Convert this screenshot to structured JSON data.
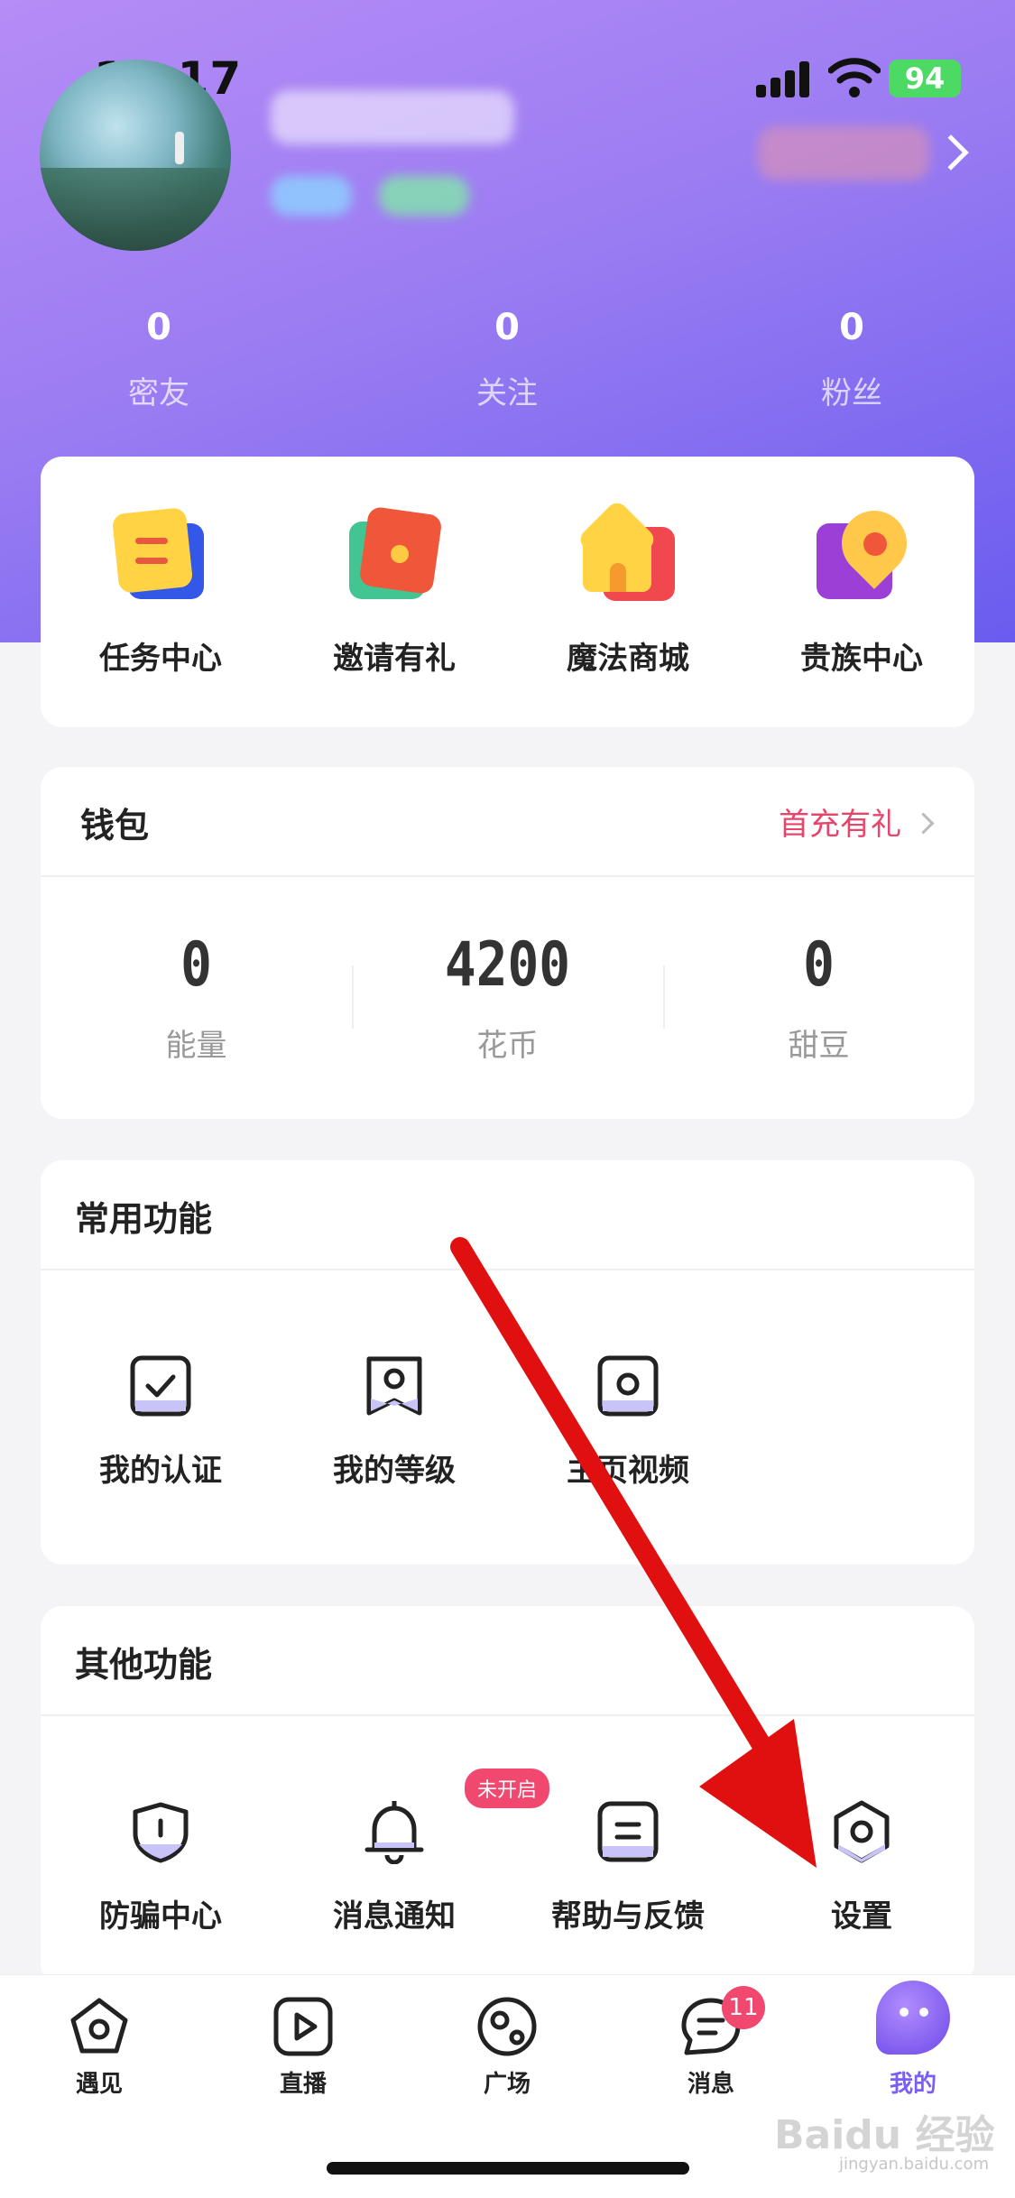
{
  "status_bar": {
    "time": "13:17",
    "battery": "94"
  },
  "profile": {
    "stats": [
      {
        "value": "0",
        "label": "密友"
      },
      {
        "value": "0",
        "label": "关注"
      },
      {
        "value": "0",
        "label": "粉丝"
      }
    ]
  },
  "quick_actions": [
    {
      "label": "任务中心",
      "icon": "task-icon"
    },
    {
      "label": "邀请有礼",
      "icon": "red-envelope-icon"
    },
    {
      "label": "魔法商城",
      "icon": "shop-icon"
    },
    {
      "label": "贵族中心",
      "icon": "noble-icon"
    }
  ],
  "wallet": {
    "title": "钱包",
    "link": "首充有礼",
    "items": [
      {
        "value": "0",
        "label": "能量"
      },
      {
        "value": "4200",
        "label": "花币"
      },
      {
        "value": "0",
        "label": "甜豆"
      }
    ]
  },
  "common": {
    "title": "常用功能",
    "items": [
      {
        "label": "我的认证",
        "icon": "verify-icon"
      },
      {
        "label": "我的等级",
        "icon": "level-icon"
      },
      {
        "label": "主页视频",
        "icon": "video-icon"
      }
    ]
  },
  "other": {
    "title": "其他功能",
    "items": [
      {
        "label": "防骗中心",
        "icon": "shield-icon"
      },
      {
        "label": "消息通知",
        "icon": "bell-icon",
        "badge": "未开启"
      },
      {
        "label": "帮助与反馈",
        "icon": "help-icon"
      },
      {
        "label": "设置",
        "icon": "settings-icon"
      }
    ]
  },
  "tabs": [
    {
      "label": "遇见",
      "icon": "meet-icon"
    },
    {
      "label": "直播",
      "icon": "live-icon"
    },
    {
      "label": "广场",
      "icon": "plaza-icon"
    },
    {
      "label": "消息",
      "icon": "message-icon",
      "badge": "11"
    },
    {
      "label": "我的",
      "icon": "mine-icon",
      "active": true
    }
  ],
  "watermark": {
    "text": "Baidu 经验",
    "sub": "jingyan.baidu.com"
  },
  "colors": {
    "accent": "#7b5cf5",
    "link": "#e8456b",
    "badge": "#f0486e",
    "annotation_arrow": "#e01010"
  }
}
